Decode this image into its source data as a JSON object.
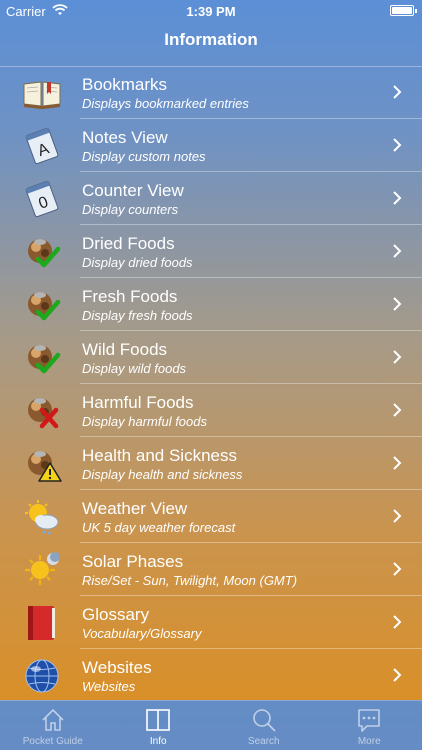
{
  "status_bar": {
    "carrier": "Carrier",
    "time": "1:39 PM"
  },
  "nav": {
    "title": "Information"
  },
  "items": [
    {
      "icon": "book-icon",
      "title": "Bookmarks",
      "subtitle": "Displays bookmarked entries"
    },
    {
      "icon": "notepad-a-icon",
      "title": "Notes View",
      "subtitle": "Display custom notes"
    },
    {
      "icon": "notepad-zero-icon",
      "title": "Counter View",
      "subtitle": "Display counters"
    },
    {
      "icon": "food-check-icon",
      "title": "Dried Foods",
      "subtitle": "Display dried foods"
    },
    {
      "icon": "food-check-icon",
      "title": "Fresh Foods",
      "subtitle": "Display fresh foods"
    },
    {
      "icon": "food-check-icon",
      "title": "Wild Foods",
      "subtitle": "Display wild foods"
    },
    {
      "icon": "food-cross-icon",
      "title": "Harmful Foods",
      "subtitle": "Display harmful foods"
    },
    {
      "icon": "food-warning-icon",
      "title": "Health and Sickness",
      "subtitle": "Display health and sickness"
    },
    {
      "icon": "weather-icon",
      "title": "Weather View",
      "subtitle": "UK 5 day weather forecast"
    },
    {
      "icon": "sun-moon-icon",
      "title": "Solar Phases",
      "subtitle": "Rise/Set - Sun, Twilight, Moon (GMT)"
    },
    {
      "icon": "red-book-icon",
      "title": "Glossary",
      "subtitle": "Vocabulary/Glossary"
    },
    {
      "icon": "globe-icon",
      "title": "Websites",
      "subtitle": "Websites"
    }
  ],
  "tabs": [
    {
      "label": "Pocket Guide",
      "icon": "house-icon",
      "active": false
    },
    {
      "label": "Info",
      "icon": "open-book-icon",
      "active": true
    },
    {
      "label": "Search",
      "icon": "magnifier-icon",
      "active": false
    },
    {
      "label": "More",
      "icon": "ellipsis-bubble-icon",
      "active": false
    }
  ]
}
